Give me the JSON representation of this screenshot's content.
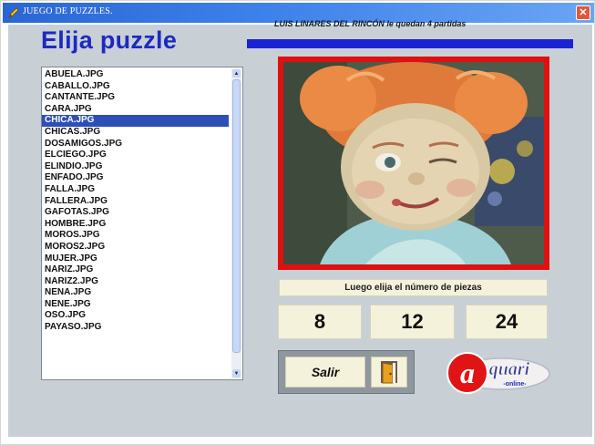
{
  "window": {
    "title": "JUEGO DE PUZZLES.",
    "close_glyph": "✕"
  },
  "heading": "Elija puzzle",
  "status_text": "LUIS LINARES DEL RINCÓN le quedan 4 partidas",
  "file_list": {
    "items": [
      "ABUELA.JPG",
      "CABALLO.JPG",
      "CANTANTE.JPG",
      "CARA.JPG",
      "CHICA.JPG",
      "CHICAS.JPG",
      "DOSAMIGOS.JPG",
      "ELCIEGO.JPG",
      "ELINDIO.JPG",
      "ENFADO.JPG",
      "FALLA.JPG",
      "FALLERA.JPG",
      "GAFOTAS.JPG",
      "HOMBRE.JPG",
      "MOROS.JPG",
      "MOROS2.JPG",
      "MUJER.JPG",
      "NARIZ.JPG",
      "NARIZ2.JPG",
      "NENA.JPG",
      "NENE.JPG",
      "OSO.JPG",
      "PAYASO.JPG"
    ],
    "selected": "CHICA.JPG"
  },
  "pieces_prompt": "Luego elija el número de piezas",
  "piece_options": {
    "eight": "8",
    "twelve": "12",
    "twentyfour": "24"
  },
  "exit_label": "Salir",
  "logo": {
    "text": "quari",
    "letter": "a",
    "subtext": "-online-"
  },
  "icons": {
    "app": "pencil-icon",
    "close": "close-icon",
    "exit": "door-icon",
    "scroll_up": "chevron-up-icon",
    "scroll_down": "chevron-down-icon"
  },
  "colors": {
    "titlebar": "#2a66d4",
    "client_bg": "#c8d0d6",
    "heading": "#1c2ac2",
    "status_bar": "#1a23d4",
    "selection": "#2e4fb8",
    "frame": "#e01010",
    "button_bg": "#f5f2dc",
    "logo_red": "#e01414"
  }
}
